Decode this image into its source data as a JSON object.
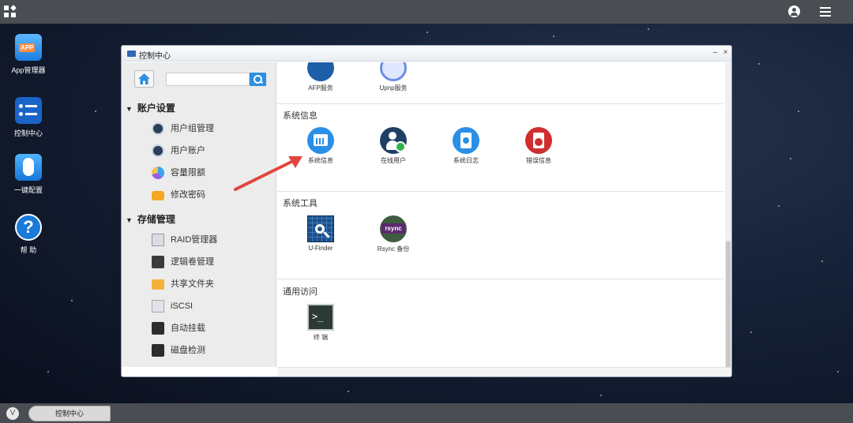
{
  "desktop": {
    "icons": [
      {
        "label": "App管理器",
        "icon": "app-manager-icon",
        "badge": "APP"
      },
      {
        "label": "控制中心",
        "icon": "control-center-icon"
      },
      {
        "label": "一键配置",
        "icon": "one-click-config-icon"
      },
      {
        "label": "帮 助",
        "icon": "help-icon",
        "glyph": "?"
      }
    ]
  },
  "window": {
    "title": "控制中心",
    "controls": {
      "minimize": "–",
      "close": "×"
    }
  },
  "sidebar": {
    "search": {
      "value": "",
      "placeholder": ""
    },
    "sections": [
      {
        "label": "账户设置",
        "items": [
          "用户组管理",
          "用户账户",
          "容量限额",
          "修改密码"
        ]
      },
      {
        "label": "存储管理",
        "items": [
          "RAID管理器",
          "逻辑卷管理",
          "共享文件夹",
          "iSCSI",
          "自动挂载",
          "磁盘检测"
        ]
      }
    ]
  },
  "main": {
    "top_items": [
      "AFP服务",
      "Upnp服务"
    ],
    "groups": [
      {
        "title": "系统信息",
        "items": [
          "系统信息",
          "在线用户",
          "系统日志",
          "错误信息"
        ]
      },
      {
        "title": "系统工具",
        "items": [
          "U-Finder",
          "Rsync 备份"
        ],
        "rsync_badge": "rsync"
      },
      {
        "title": "通用访问",
        "items": [
          "终 端"
        ],
        "terminal_glyph": ">_"
      }
    ]
  },
  "taskbar": {
    "task_label": "控制中心",
    "logo_glyph": "V"
  },
  "colors": {
    "accent": "#2c8fe0",
    "arrow": "#e0453e",
    "topbar": "#4a4d52"
  }
}
